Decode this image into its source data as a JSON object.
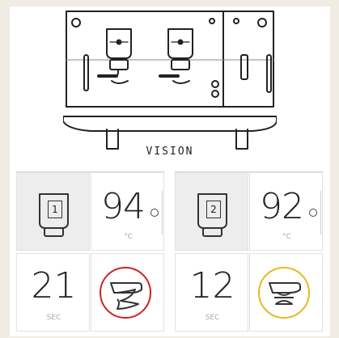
{
  "machine": {
    "name": "VISION",
    "icon": "espresso-machine-icon"
  },
  "groups": [
    {
      "group_number": "1",
      "temperature": "94",
      "temperature_unit": "°C",
      "shot_time": "21",
      "shot_time_unit": "SEC",
      "status_color": "#cc2222",
      "status_icon": "portafilter-icon"
    },
    {
      "group_number": "2",
      "temperature": "92",
      "temperature_unit": "°C",
      "shot_time": "12",
      "shot_time_unit": "SEC",
      "status_color": "#e8b820",
      "status_icon": "portafilter-icon"
    }
  ]
}
